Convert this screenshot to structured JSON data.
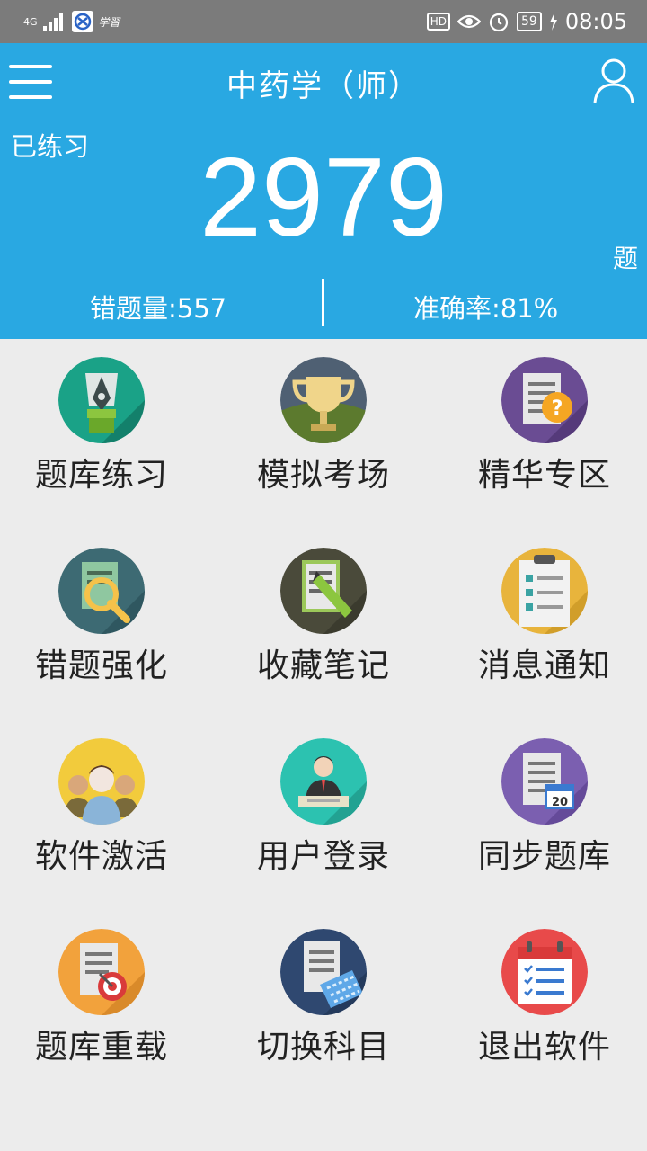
{
  "status_bar": {
    "network": "4G",
    "app_hint": "学習",
    "hd": "HD",
    "battery": "59",
    "time": "08:05"
  },
  "header": {
    "title": "中药学（师）",
    "practiced_label": "已练习",
    "count": "2979",
    "unit": "题",
    "wrong_label": "错题量:557",
    "accuracy_label": "准确率:81%"
  },
  "menu": [
    {
      "label": "题库练习",
      "icon": "pen-nib-icon",
      "color": "#1aa287"
    },
    {
      "label": "模拟考场",
      "icon": "trophy-icon",
      "color": "#4f6073"
    },
    {
      "label": "精华专区",
      "icon": "document-question-icon",
      "color": "#6a4c93"
    },
    {
      "label": "错题强化",
      "icon": "document-search-icon",
      "color": "#3d6a73"
    },
    {
      "label": "收藏笔记",
      "icon": "document-pencil-icon",
      "color": "#4a4a3a"
    },
    {
      "label": "消息通知",
      "icon": "clipboard-checklist-icon",
      "color": "#e8b43c"
    },
    {
      "label": "软件激活",
      "icon": "users-group-icon",
      "color": "#f2cb3c"
    },
    {
      "label": "用户登录",
      "icon": "user-desk-icon",
      "color": "#2cc2b0"
    },
    {
      "label": "同步题库",
      "icon": "document-calendar-icon",
      "color": "#7b5fb0"
    },
    {
      "label": "题库重载",
      "icon": "document-target-icon",
      "color": "#f2a23c"
    },
    {
      "label": "切换科目",
      "icon": "document-keyboard-icon",
      "color": "#2f4870"
    },
    {
      "label": "退出软件",
      "icon": "calendar-list-icon",
      "color": "#e84a4a"
    }
  ]
}
